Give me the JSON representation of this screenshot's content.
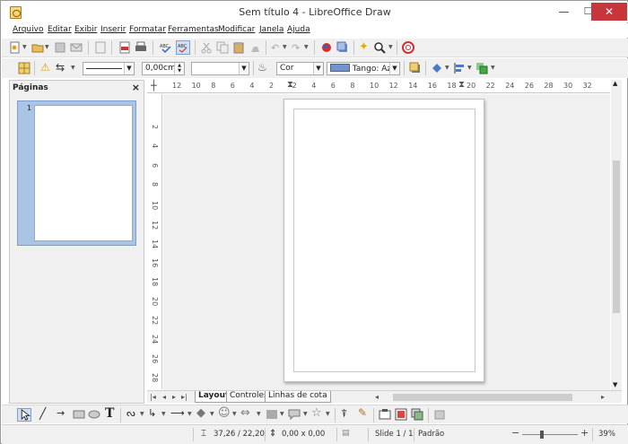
{
  "window": {
    "title": "Sem título 4 - LibreOffice Draw",
    "minimize": "—",
    "maximize": "☐",
    "close": "✕"
  },
  "menu": [
    "Arquivo",
    "Editar",
    "Exibir",
    "Inserir",
    "Formatar",
    "Ferramentas",
    "Modificar",
    "Janela",
    "Ajuda"
  ],
  "line_props": {
    "width_value": "0,00cm",
    "color_value": "",
    "area_style": "Cor",
    "area_color": "Tango: Azu",
    "area_swatch_color": "#7293cb"
  },
  "pages_panel": {
    "title": "Páginas",
    "close": "×",
    "pages": [
      {
        "number": "1"
      }
    ]
  },
  "ruler": {
    "h_ticks": [
      "12",
      "10",
      "8",
      "6",
      "4",
      "2",
      "2",
      "4",
      "6",
      "8",
      "10",
      "12",
      "14",
      "16",
      "18",
      "20",
      "22",
      "24",
      "26",
      "28",
      "30",
      "32"
    ],
    "v_ticks": [
      "2",
      "4",
      "6",
      "8",
      "10",
      "12",
      "14",
      "16",
      "18",
      "20",
      "22",
      "24",
      "26",
      "28"
    ]
  },
  "tabs": [
    "Layout",
    "Controles",
    "Linhas de cota"
  ],
  "status": {
    "position": "37,26 / 22,20",
    "size": "0,00 x 0,00",
    "slide": "Slide 1 / 1",
    "master": "Padrão",
    "zoom_minus": "−",
    "zoom_plus": "+",
    "zoom_level": "39%",
    "zoom_fraction": 0.39
  },
  "colors": {
    "accent_selection": "#a9c4e4",
    "close_button": "#c7363b"
  }
}
